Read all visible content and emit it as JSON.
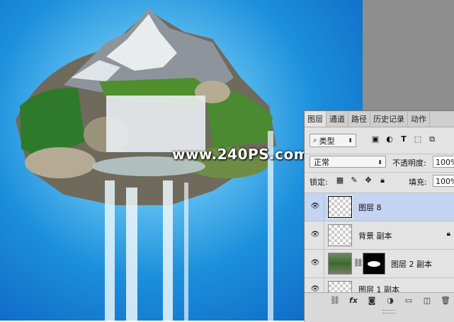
{
  "watermark": "www.240PS.com",
  "layers_panel": {
    "tabs": [
      {
        "label": "图层",
        "active": true
      },
      {
        "label": "通道",
        "active": false
      },
      {
        "label": "路径",
        "active": false
      },
      {
        "label": "历史记录",
        "active": false
      },
      {
        "label": "动作",
        "active": false
      }
    ],
    "filter": {
      "kind_label": "类型",
      "icons": [
        "image-filter-icon",
        "adjustment-filter-icon",
        "text-filter-icon",
        "shape-filter-icon",
        "smart-object-filter-icon"
      ]
    },
    "blend_mode": "正常",
    "opacity_label": "不透明度:",
    "opacity_value": "100%",
    "lock_label": "锁定:",
    "fill_label": "填充:",
    "fill_value": "100%",
    "layers": [
      {
        "name": "图层 8",
        "selected": true,
        "visible": true
      },
      {
        "name": "背景 副本",
        "selected": false,
        "visible": true,
        "locked": true
      },
      {
        "name": "图层 2 副本",
        "selected": false,
        "visible": true,
        "has_mask": true
      },
      {
        "name": "图层 1 副本",
        "selected": false,
        "visible": true
      }
    ],
    "footer_icons": [
      "link-layers-icon",
      "fx-icon",
      "add-mask-icon",
      "adjustment-layer-icon",
      "new-group-icon",
      "new-layer-icon",
      "delete-layer-icon"
    ],
    "fx_label": "fx"
  },
  "colors": {
    "sky_blue": "#1c8fdc",
    "selected_layer": "#c4d4f2",
    "panel_bg": "#e3e3e3"
  }
}
